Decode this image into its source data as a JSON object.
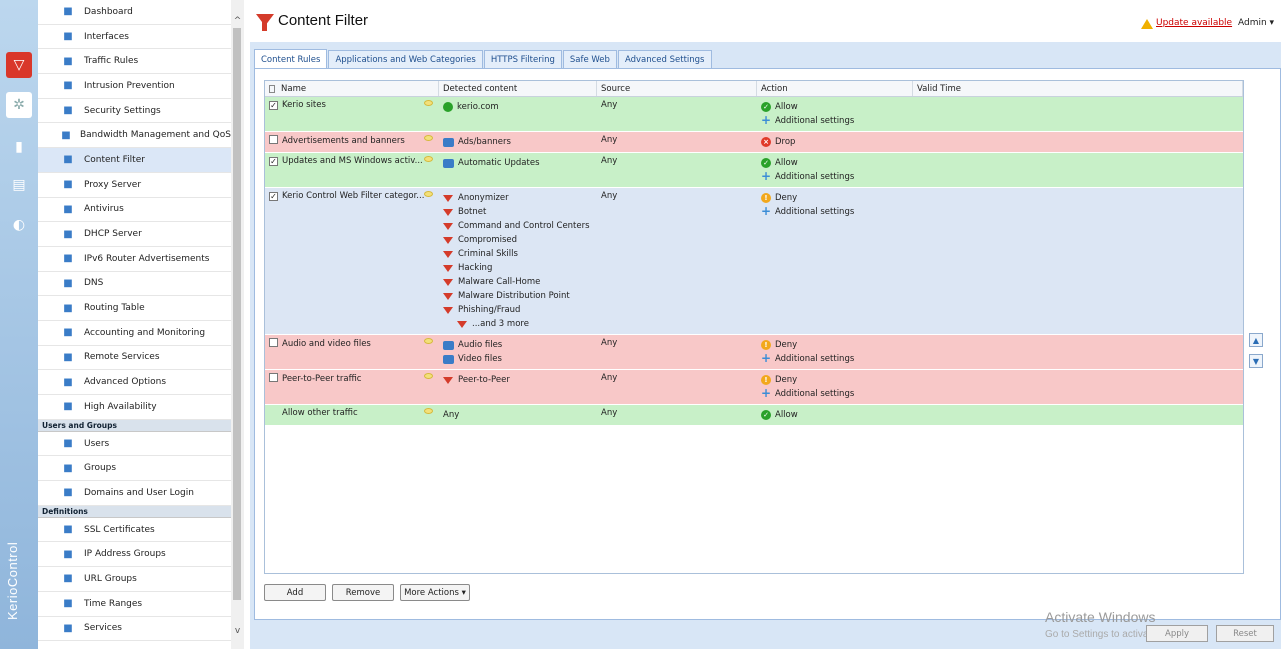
{
  "brand": "KerioControl",
  "header": {
    "title": "Content Filter",
    "update_label": "Update available",
    "admin_label": "Admin ▾"
  },
  "sidebar": {
    "items": [
      {
        "label": "Dashboard",
        "icon": "dashboard-icon"
      },
      {
        "label": "Interfaces",
        "icon": "interfaces-icon"
      },
      {
        "label": "Traffic Rules",
        "icon": "traffic-rules-icon"
      },
      {
        "label": "Intrusion Prevention",
        "icon": "shield-icon"
      },
      {
        "label": "Security Settings",
        "icon": "security-icon"
      },
      {
        "label": "Bandwidth Management and QoS",
        "icon": "bandwidth-icon"
      },
      {
        "label": "Content Filter",
        "icon": "funnel-icon"
      },
      {
        "label": "Proxy Server",
        "icon": "proxy-icon"
      },
      {
        "label": "Antivirus",
        "icon": "antivirus-icon"
      },
      {
        "label": "DHCP Server",
        "icon": "dhcp-icon"
      },
      {
        "label": "IPv6 Router Advertisements",
        "icon": "ipv6-icon"
      },
      {
        "label": "DNS",
        "icon": "dns-icon"
      },
      {
        "label": "Routing Table",
        "icon": "routing-icon"
      },
      {
        "label": "Accounting and Monitoring",
        "icon": "accounting-icon"
      },
      {
        "label": "Remote Services",
        "icon": "cloud-icon"
      },
      {
        "label": "Advanced Options",
        "icon": "gear-icon"
      },
      {
        "label": "High Availability",
        "icon": "ha-icon"
      }
    ],
    "section_users": "Users and Groups",
    "users_items": [
      {
        "label": "Users",
        "icon": "user-icon"
      },
      {
        "label": "Groups",
        "icon": "group-icon"
      },
      {
        "label": "Domains and User Login",
        "icon": "domain-icon"
      }
    ],
    "section_defs": "Definitions",
    "defs_items": [
      {
        "label": "SSL Certificates",
        "icon": "certificate-icon"
      },
      {
        "label": "IP Address Groups",
        "icon": "ip-group-icon"
      },
      {
        "label": "URL Groups",
        "icon": "url-group-icon"
      },
      {
        "label": "Time Ranges",
        "icon": "clock-icon"
      },
      {
        "label": "Services",
        "icon": "services-icon"
      }
    ]
  },
  "tabs": [
    "Content Rules",
    "Applications and Web Categories",
    "HTTPS Filtering",
    "Safe Web",
    "Advanced Settings"
  ],
  "columns": [
    "Name",
    "Detected content",
    "Source",
    "Action",
    "Valid Time"
  ],
  "rules": [
    {
      "name": "Kerio sites",
      "checked": true,
      "color": "green",
      "content": [
        "kerio.com"
      ],
      "source": "Any",
      "action": "Allow",
      "extra": "Additional settings"
    },
    {
      "name": "Advertisements and banners",
      "checked": false,
      "color": "red",
      "content": [
        "Ads/banners"
      ],
      "source": "Any",
      "action": "Drop",
      "extra": ""
    },
    {
      "name": "Updates and MS Windows activ...",
      "checked": true,
      "color": "green",
      "content": [
        "Automatic Updates"
      ],
      "source": "Any",
      "action": "Allow",
      "extra": "Additional settings"
    },
    {
      "name": "Kerio Control Web Filter categor...",
      "checked": true,
      "color": "blue",
      "content": [
        "Anonymizer",
        "Botnet",
        "Command and Control Centers",
        "Compromised",
        "Criminal Skills",
        "Hacking",
        "Malware Call-Home",
        "Malware Distribution Point",
        "Phishing/Fraud",
        "...and 3 more"
      ],
      "source": "Any",
      "action": "Deny",
      "extra": "Additional settings"
    },
    {
      "name": "Audio and video files",
      "checked": false,
      "color": "red",
      "content": [
        "Audio files",
        "Video files"
      ],
      "source": "Any",
      "action": "Deny",
      "extra": "Additional settings"
    },
    {
      "name": "Peer-to-Peer traffic",
      "checked": false,
      "color": "red",
      "content": [
        "Peer-to-Peer"
      ],
      "source": "Any",
      "action": "Deny",
      "extra": "Additional settings"
    },
    {
      "name": "Allow other traffic",
      "checked": null,
      "color": "green",
      "content": [
        "Any"
      ],
      "source": "Any",
      "action": "Allow",
      "extra": ""
    }
  ],
  "buttons": {
    "add": "Add",
    "remove": "Remove",
    "more": "More Actions ▾",
    "apply": "Apply",
    "reset": "Reset"
  },
  "watermark": {
    "line1": "Activate Windows",
    "line2": "Go to Settings to activate Windows."
  },
  "colors": {
    "accent": "#d43b2a",
    "allow_row": "#c8f0c8",
    "deny_row": "#f8c8c8",
    "cat_row": "#dce6f4"
  }
}
